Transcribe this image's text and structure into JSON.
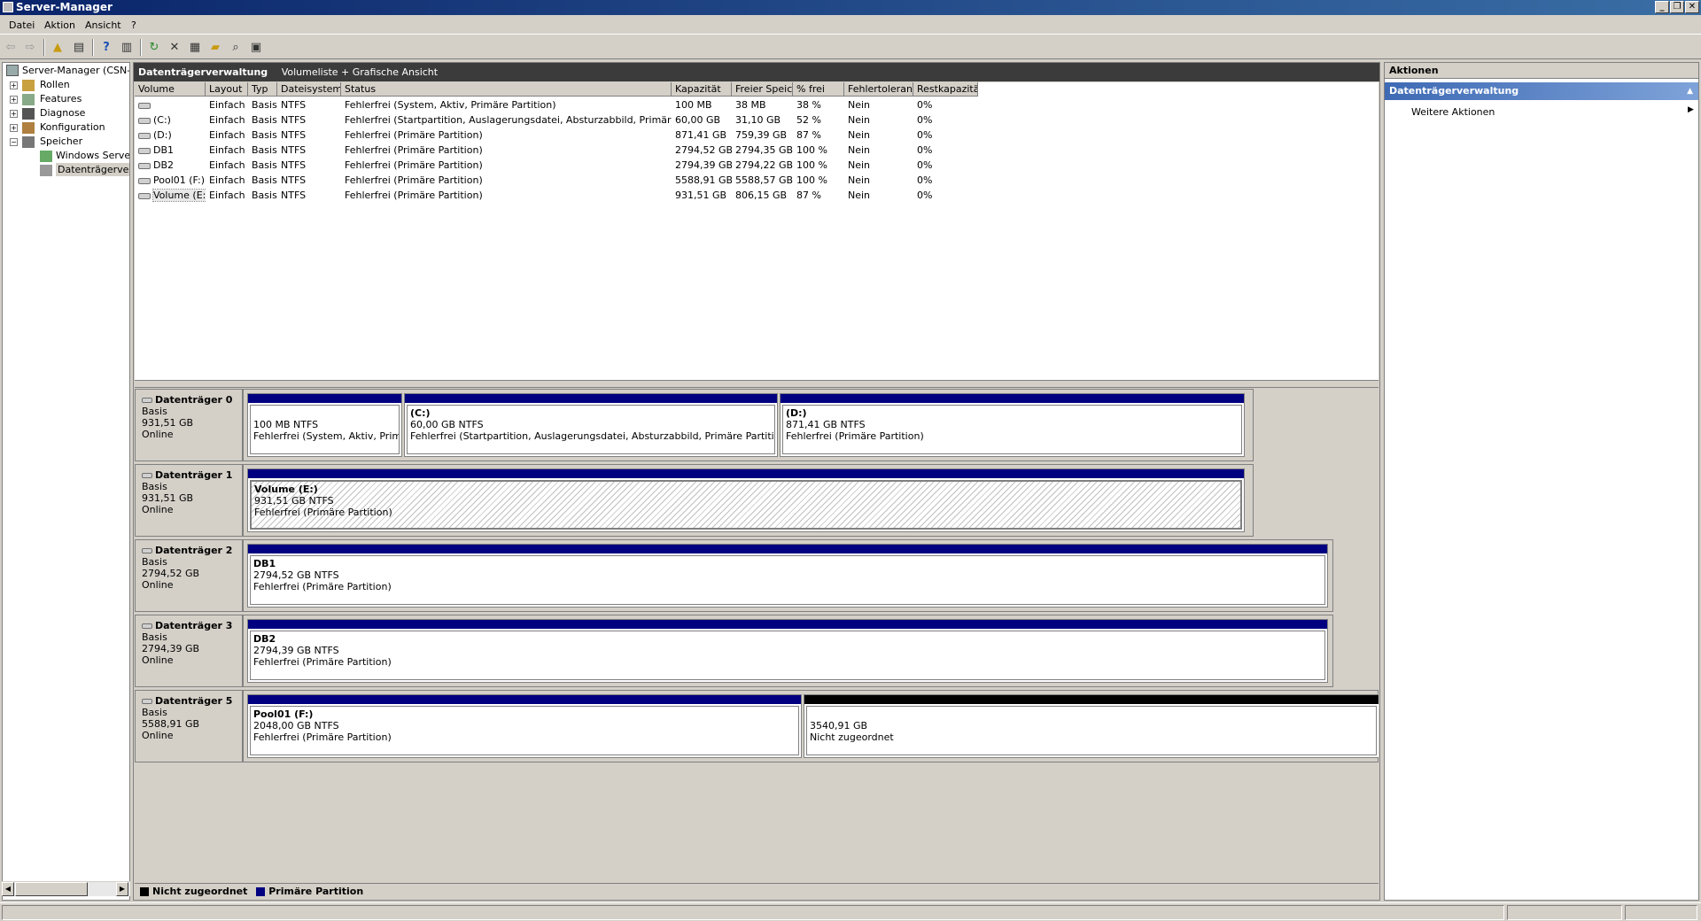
{
  "window": {
    "title": "Server-Manager"
  },
  "menu": [
    "Datei",
    "Aktion",
    "Ansicht",
    "?"
  ],
  "tree": {
    "root": "Server-Manager (CSN-W",
    "items": [
      "Rollen",
      "Features",
      "Diagnose",
      "Konfiguration",
      "Speicher"
    ],
    "speicher_children": [
      "Windows Server-",
      "Datenträgerverw"
    ]
  },
  "center": {
    "title": "Datenträgerverwaltung",
    "view": "Volumeliste + Grafische Ansicht"
  },
  "volume_columns": [
    "Volume",
    "Layout",
    "Typ",
    "Dateisystem",
    "Status",
    "Kapazität",
    "Freier Speicher",
    "% frei",
    "Fehlertoleranz",
    "Restkapazität"
  ],
  "volumes": [
    [
      "",
      "Einfach",
      "Basis",
      "NTFS",
      "Fehlerfrei (System, Aktiv, Primäre Partition)",
      "100 MB",
      "38 MB",
      "38 %",
      "Nein",
      "0%"
    ],
    [
      "(C:)",
      "Einfach",
      "Basis",
      "NTFS",
      "Fehlerfrei (Startpartition, Auslagerungsdatei, Absturzabbild, Primäre Partition)",
      "60,00 GB",
      "31,10 GB",
      "52 %",
      "Nein",
      "0%"
    ],
    [
      "(D:)",
      "Einfach",
      "Basis",
      "NTFS",
      "Fehlerfrei (Primäre Partition)",
      "871,41 GB",
      "759,39 GB",
      "87 %",
      "Nein",
      "0%"
    ],
    [
      "DB1",
      "Einfach",
      "Basis",
      "NTFS",
      "Fehlerfrei (Primäre Partition)",
      "2794,52 GB",
      "2794,35 GB",
      "100 %",
      "Nein",
      "0%"
    ],
    [
      "DB2",
      "Einfach",
      "Basis",
      "NTFS",
      "Fehlerfrei (Primäre Partition)",
      "2794,39 GB",
      "2794,22 GB",
      "100 %",
      "Nein",
      "0%"
    ],
    [
      "Pool01 (F:)",
      "Einfach",
      "Basis",
      "NTFS",
      "Fehlerfrei (Primäre Partition)",
      "5588,91 GB",
      "5588,57 GB",
      "100 %",
      "Nein",
      "0%"
    ],
    [
      "Volume (E:)",
      "Einfach",
      "Basis",
      "NTFS",
      "Fehlerfrei (Primäre Partition)",
      "931,51 GB",
      "806,15 GB",
      "87 %",
      "Nein",
      "0%"
    ]
  ],
  "disks": [
    {
      "name": "Datenträger 0",
      "type": "Basis",
      "size": "931,51 GB",
      "state": "Online",
      "partitions": [
        {
          "name": "",
          "size": "100 MB NTFS",
          "status": "Fehlerfrei (System, Aktiv, Primäre"
        },
        {
          "name": "(C:)",
          "size": "60,00 GB NTFS",
          "status": "Fehlerfrei (Startpartition, Auslagerungsdatei, Absturzabbild, Primäre Partition)"
        },
        {
          "name": "(D:)",
          "size": "871,41 GB NTFS",
          "status": "Fehlerfrei (Primäre Partition)"
        }
      ]
    },
    {
      "name": "Datenträger 1",
      "type": "Basis",
      "size": "931,51 GB",
      "state": "Online",
      "partitions": [
        {
          "name": "Volume  (E:)",
          "size": "931,51 GB NTFS",
          "status": "Fehlerfrei (Primäre Partition)"
        }
      ]
    },
    {
      "name": "Datenträger 2",
      "type": "Basis",
      "size": "2794,52 GB",
      "state": "Online",
      "partitions": [
        {
          "name": "DB1",
          "size": "2794,52 GB NTFS",
          "status": "Fehlerfrei (Primäre Partition)"
        }
      ]
    },
    {
      "name": "Datenträger 3",
      "type": "Basis",
      "size": "2794,39 GB",
      "state": "Online",
      "partitions": [
        {
          "name": "DB2",
          "size": "2794,39 GB NTFS",
          "status": "Fehlerfrei (Primäre Partition)"
        }
      ]
    },
    {
      "name": "Datenträger 5",
      "type": "Basis",
      "size": "5588,91 GB",
      "state": "Online",
      "partitions": [
        {
          "name": "Pool01  (F:)",
          "size": "2048,00 GB NTFS",
          "status": "Fehlerfrei (Primäre Partition)"
        },
        {
          "name": "",
          "size": "3540,91 GB",
          "status": "Nicht zugeordnet"
        }
      ]
    }
  ],
  "legend": [
    "Nicht zugeordnet",
    "Primäre Partition"
  ],
  "legend_colors": [
    "#000000",
    "#000080"
  ],
  "actions": {
    "header": "Aktionen",
    "section": "Datenträgerverwaltung",
    "item": "Weitere Aktionen"
  }
}
